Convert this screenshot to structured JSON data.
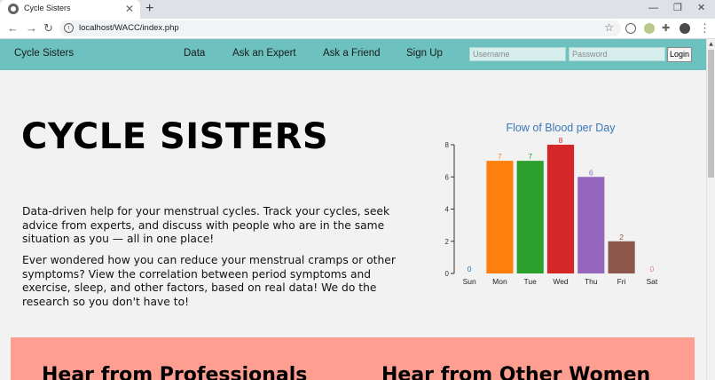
{
  "browser": {
    "tab_title": "Cycle Sisters",
    "tab_close": "✕",
    "new_tab": "+",
    "url": "localhost/WACC/index.php",
    "minimize": "—",
    "restore": "❐",
    "close": "✕",
    "back": "←",
    "forward": "→",
    "reload": "↻",
    "info": "i",
    "star": "☆",
    "puzzle": "✚",
    "menu": "⋮"
  },
  "nav": {
    "brand": "Cycle Sisters",
    "links": [
      "Data",
      "Ask an Expert",
      "Ask a Friend",
      "Sign Up"
    ],
    "username_placeholder": "Username",
    "password_placeholder": "Password",
    "login_label": "Login"
  },
  "hero": {
    "title": "CYCLE SISTERS",
    "paragraph1": "Data-driven help for your menstrual cycles. Track your cycles, seek advice from experts, and discuss with people who are in the same situation as you — all in one place!",
    "paragraph2": "Ever wondered how you can reduce your menstrual cramps or other symptoms? View the correlation between period symptoms and exercise, sleep, and other factors, based on real data! We do the research so you don't have to!"
  },
  "colors": {
    "nav_bg": "#6dc2c0",
    "pink_section": "#fd9e90",
    "chart_title": "#3b78b8"
  },
  "chart_data": {
    "type": "bar",
    "title": "Flow of Blood per Day",
    "categories": [
      "Sun",
      "Mon",
      "Tue",
      "Wed",
      "Thu",
      "Fri",
      "Sat"
    ],
    "values": [
      0,
      7,
      7,
      8,
      6,
      2,
      0
    ],
    "colors": [
      "#1f77b4",
      "#ff7f0e",
      "#2ca02c",
      "#d62728",
      "#9467bd",
      "#8c564b",
      "#e377c2"
    ],
    "yticks": [
      0,
      2,
      4,
      6,
      8
    ],
    "ylim": [
      0,
      8
    ],
    "xlabel": "",
    "ylabel": "",
    "grid": false,
    "legend": "none"
  },
  "sections": {
    "left_heading": "Hear from Professionals",
    "right_heading": "Hear from Other Women"
  }
}
